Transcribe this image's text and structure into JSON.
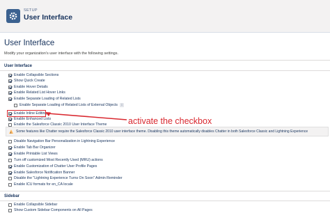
{
  "header": {
    "setup_label": "SETUP",
    "title": "User Interface"
  },
  "main": {
    "title": "User Interface",
    "description": "Modify your organization's user interface with the following settings."
  },
  "user_interface_section": {
    "header": "User Interface",
    "items_top": [
      {
        "label": "Enable Collapsible Sections",
        "checked": true
      },
      {
        "label": "Show Quick Create",
        "checked": true
      },
      {
        "label": "Enable Hover Details",
        "checked": true
      },
      {
        "label": "Enable Related List Hover Links",
        "checked": true
      },
      {
        "label": "Enable Separate Loading of Related Lists",
        "checked": true
      }
    ],
    "item_indented": {
      "label": "Enable Separate Loading of Related Lists of External Objects",
      "checked": false,
      "info": "i"
    },
    "items_mid": [
      {
        "label": "Enable Inline Editing",
        "checked": true
      },
      {
        "label": "Enable Enhanced Lists",
        "checked": true
      },
      {
        "label": "Enable the Salesforce Classic 2010 User Interface Theme",
        "checked": false
      }
    ],
    "warning": "Some features like Chatter require the Salesforce Classic 2010 user interface theme. Disabling this theme automatically disables Chatter in both Salesforce Classic and Lightning Experience",
    "items_bottom": [
      {
        "label": "Disable Navigation Bar Personalization in Lightning Experience",
        "checked": false
      },
      {
        "label": "Enable Tab Bar Organizer",
        "checked": true
      },
      {
        "label": "Enable Printable List Views",
        "checked": true
      },
      {
        "label": "Turn off customized Most Recently Used (MRU) actions",
        "checked": false
      },
      {
        "label": "Enable Customization of Chatter User Profile Pages",
        "checked": true
      },
      {
        "label": "Enable Salesforce Notification Banner",
        "checked": true
      },
      {
        "label": "Disable the \"Lightning Experience Turns On Soon\" Admin Reminder",
        "checked": false
      },
      {
        "label": "Enable ICU formats for en_CA locale",
        "checked": false
      }
    ]
  },
  "sidebar_section": {
    "header": "Sidebar",
    "items": [
      {
        "label": "Enable Collapsible Sidebar",
        "checked": false
      },
      {
        "label": "Show Custom Sidebar Components on All Pages",
        "checked": false
      }
    ]
  },
  "annotation": {
    "text": "activate the checkbox",
    "color": "#d9282f"
  },
  "colors": {
    "setup_icon": "#3c6290",
    "warning_icon": "#ffb75d"
  },
  "icons": {
    "setup": "gear-icon",
    "warning": "warning-icon"
  }
}
